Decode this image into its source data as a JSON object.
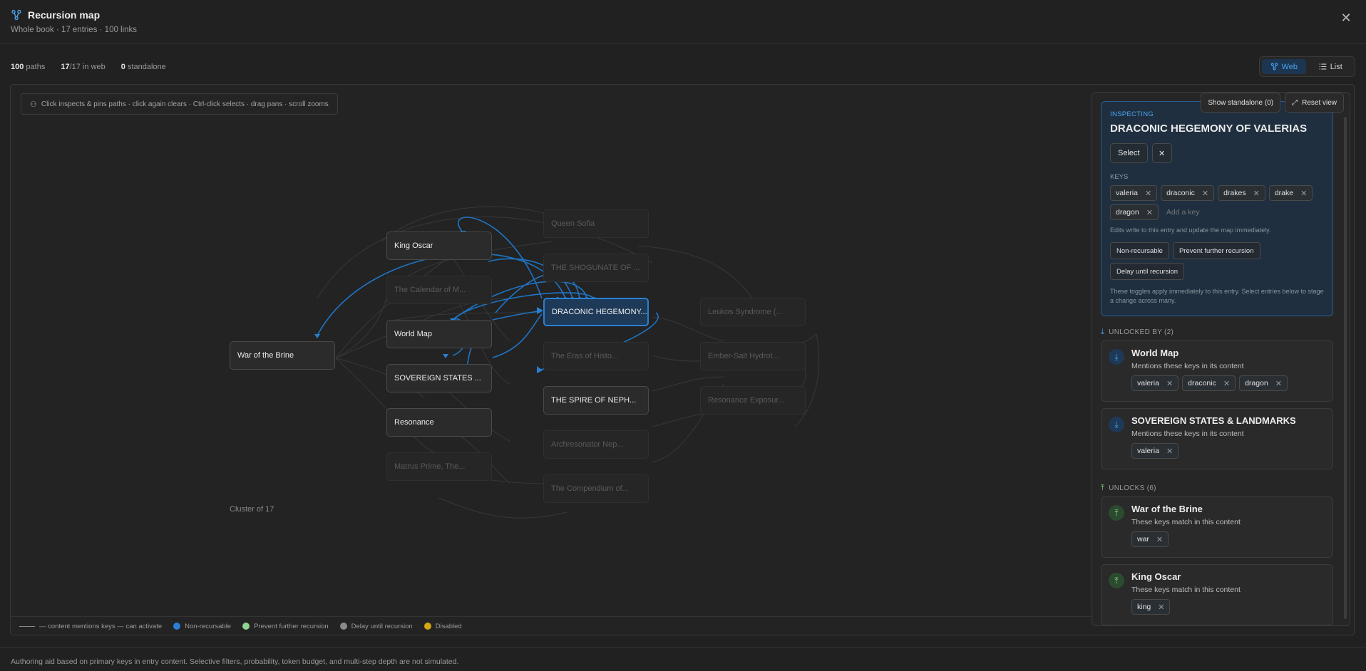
{
  "header": {
    "title": "Recursion map",
    "subtitle": "Whole book · 17 entries · 100 links",
    "close_label": "✕"
  },
  "stats": {
    "paths_count": "100",
    "paths_label": "paths",
    "web_count": "17",
    "web_total": "/17",
    "web_label": "in web",
    "standalone_count": "0",
    "standalone_label": "standalone"
  },
  "view_toggle": {
    "web_label": "Web",
    "list_label": "List",
    "selected": "Web"
  },
  "canvas": {
    "hint": "Click inspects & pins paths · click again clears · Ctrl-click selects · drag pans · scroll zooms",
    "cluster_label": "Cluster of 17",
    "nodes": [
      {
        "id": "war",
        "label": "War of the Brine",
        "state": "normal"
      },
      {
        "id": "king",
        "label": "King Oscar",
        "state": "normal"
      },
      {
        "id": "calendar",
        "label": "The Calendar of M...",
        "state": "dim"
      },
      {
        "id": "worldmap",
        "label": "World Map",
        "state": "normal"
      },
      {
        "id": "sovereign",
        "label": "SOVEREIGN STATES ...",
        "state": "normal"
      },
      {
        "id": "resonance",
        "label": "Resonance",
        "state": "normal"
      },
      {
        "id": "matrus",
        "label": "Matrus Prime, The...",
        "state": "dim"
      },
      {
        "id": "queen",
        "label": "Queen Sofia",
        "state": "dim"
      },
      {
        "id": "shogunate",
        "label": "THE SHOGUNATE OF ...",
        "state": "dim"
      },
      {
        "id": "draconic",
        "label": "DRACONIC HEGEMONY...",
        "state": "focus"
      },
      {
        "id": "eras",
        "label": "The Eras of Histo...",
        "state": "dim"
      },
      {
        "id": "spire",
        "label": "THE SPIRE OF NEPH...",
        "state": "normal"
      },
      {
        "id": "archresonator",
        "label": "Archresonator Nep...",
        "state": "dim"
      },
      {
        "id": "compendium",
        "label": "The Compendium of...",
        "state": "dim"
      },
      {
        "id": "leukos",
        "label": "Leukos Syndrome (...",
        "state": "dim"
      },
      {
        "id": "embersalt",
        "label": "Ember-Salt Hydrot...",
        "state": "dim"
      },
      {
        "id": "resexposure",
        "label": "Resonance Exposur...",
        "state": "dim"
      }
    ]
  },
  "legend": {
    "line_label": "— content mentions keys — can activate",
    "items": [
      {
        "label": "Non-recursable",
        "color": "#2a7fd3"
      },
      {
        "label": "Prevent further recursion",
        "color": "#8fd48f"
      },
      {
        "label": "Delay until recursion",
        "color": "#8a8a8a"
      },
      {
        "label": "Disabled",
        "color": "#d4a514"
      }
    ]
  },
  "panel": {
    "show_standalone": "Show standalone (0)",
    "reset_view": "Reset view",
    "inspecting_label": "INSPECTING",
    "entry_name": "DRACONIC HEGEMONY OF VALERIAS",
    "select_label": "Select",
    "keys_label": "KEYS",
    "keys": [
      "valeria",
      "draconic",
      "drakes",
      "drake",
      "dragon"
    ],
    "add_key_placeholder": "Add a key",
    "edits_note": "Edits write to this entry and update the map immediately.",
    "toggles": [
      "Non-recursable",
      "Prevent further recursion",
      "Delay until recursion"
    ],
    "toggles_note": "These toggles apply immediately to this entry. Select entries below to stage a change across many.",
    "unlocked_by_label": "UNLOCKED BY (2)",
    "unlocked_by": [
      {
        "title": "World Map",
        "desc": "Mentions these keys in its content",
        "keys": [
          "valeria",
          "draconic",
          "dragon"
        ]
      },
      {
        "title": "SOVEREIGN STATES & LANDMARKS",
        "desc": "Mentions these keys in its content",
        "keys": [
          "valeria"
        ]
      }
    ],
    "unlocks_label": "UNLOCKS (6)",
    "unlocks": [
      {
        "title": "War of the Brine",
        "desc": "These keys match in this content",
        "keys": [
          "war"
        ]
      },
      {
        "title": "King Oscar",
        "desc": "These keys match in this content",
        "keys": [
          "king"
        ]
      }
    ]
  },
  "footer": {
    "text": "Authoring aid based on primary keys in entry content. Selective filters, probability, token budget, and multi-step depth are not simulated."
  },
  "colors": {
    "accent": "#2a7fd3",
    "background": "#212121",
    "edge_dim": "#3a3a3a"
  }
}
